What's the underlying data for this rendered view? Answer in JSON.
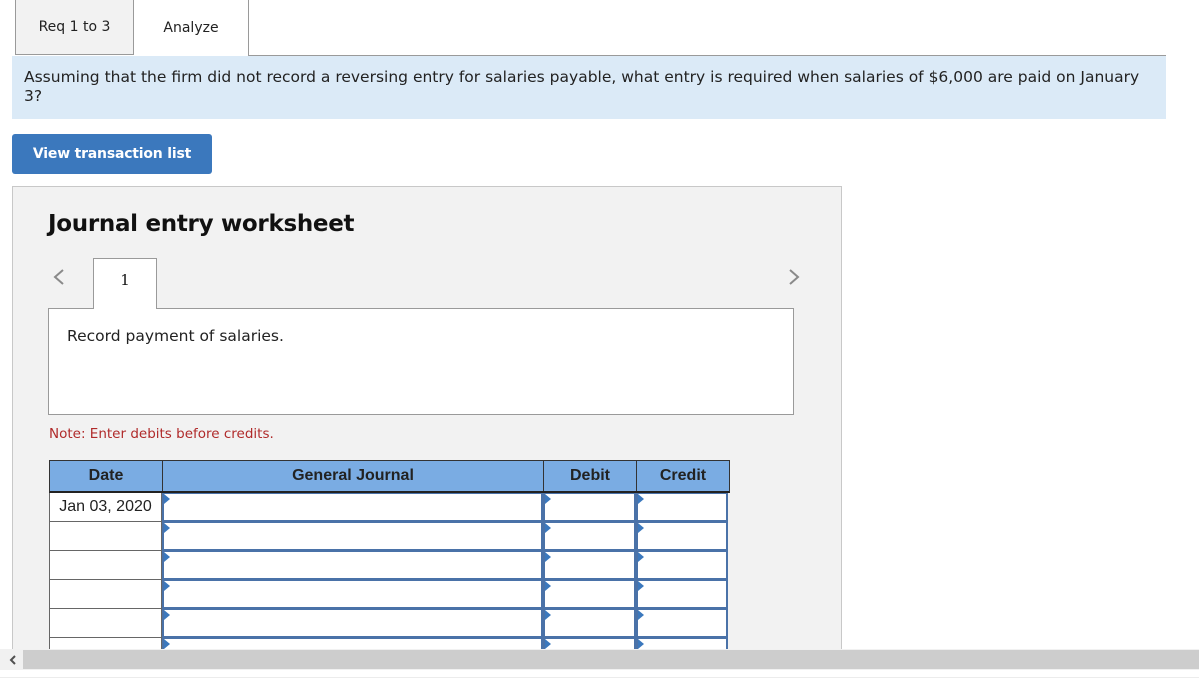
{
  "tabs": [
    {
      "label": "Req 1 to 3",
      "active": false
    },
    {
      "label": "Analyze",
      "active": true
    }
  ],
  "question": {
    "text": "Assuming that the firm did not record a reversing entry for salaries payable, what entry is required when salaries of $6,000 are paid on January 3?"
  },
  "toolbar": {
    "view_transaction_list_label": "View transaction list"
  },
  "worksheet": {
    "title": "Journal entry worksheet",
    "prev_icon": "chevron-left-icon",
    "next_icon": "chevron-right-icon",
    "entry_tabs": [
      {
        "label": "1"
      }
    ],
    "entry_description": "Record payment of salaries.",
    "note": "Note: Enter debits before credits.",
    "journal": {
      "columns": [
        "Date",
        "General Journal",
        "Debit",
        "Credit"
      ],
      "rows": [
        {
          "date": "Jan 03, 2020",
          "account": "",
          "debit": "",
          "credit": ""
        },
        {
          "date": "",
          "account": "",
          "debit": "",
          "credit": ""
        },
        {
          "date": "",
          "account": "",
          "debit": "",
          "credit": ""
        },
        {
          "date": "",
          "account": "",
          "debit": "",
          "credit": ""
        },
        {
          "date": "",
          "account": "",
          "debit": "",
          "credit": ""
        },
        {
          "date": "",
          "account": "",
          "debit": "",
          "credit": ""
        }
      ]
    }
  },
  "colors": {
    "accent": "#3b78bd",
    "question_bg": "#dbeaf7",
    "table_header_bg": "#7aace3",
    "note_text": "#b02a2a",
    "panel_bg": "#f2f2f2"
  }
}
